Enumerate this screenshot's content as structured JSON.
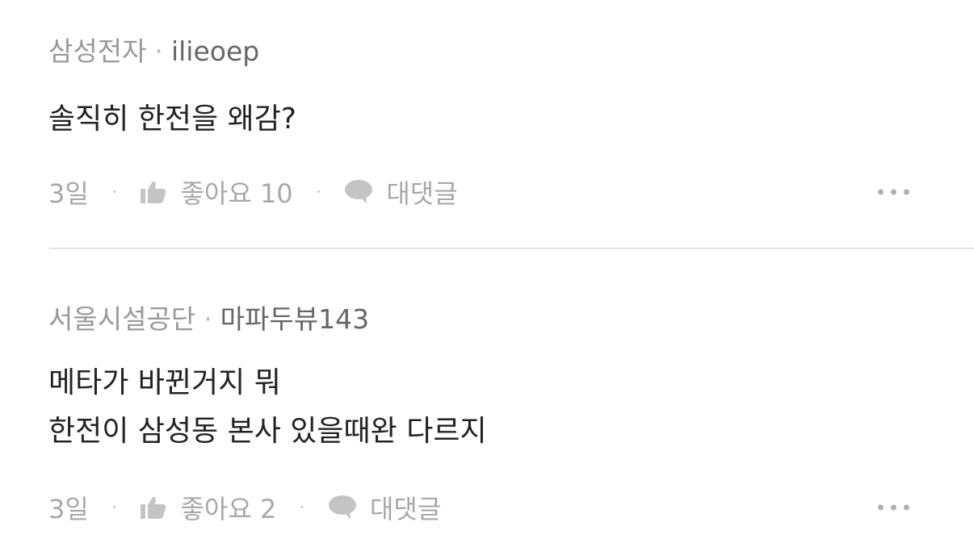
{
  "comments": [
    {
      "company": "삼성전자",
      "separator": "·",
      "author": "ilieoep",
      "lines": [
        "솔직히 한전을 왜감?"
      ],
      "time": "3일",
      "like_label": "좋아요 10",
      "reply_label": "대댓글"
    },
    {
      "company": "서울시설공단",
      "separator": "·",
      "author": "마파두뷰143",
      "lines": [
        "메타가 바뀐거지 뭐",
        "한전이 삼성동 본사 있을때완 다르지"
      ],
      "time": "3일",
      "like_label": "좋아요 2",
      "reply_label": "대댓글"
    }
  ],
  "icons": {
    "like": "thumbs-up-icon",
    "reply": "speech-bubble-icon",
    "more": "more-horizontal-icon"
  },
  "colors": {
    "meta_text": "#999999",
    "author_text": "#666666",
    "body_text": "#222222",
    "action_text": "#a8a8a8",
    "icon": "#c4c4c4",
    "divider": "#e6e6e6"
  }
}
